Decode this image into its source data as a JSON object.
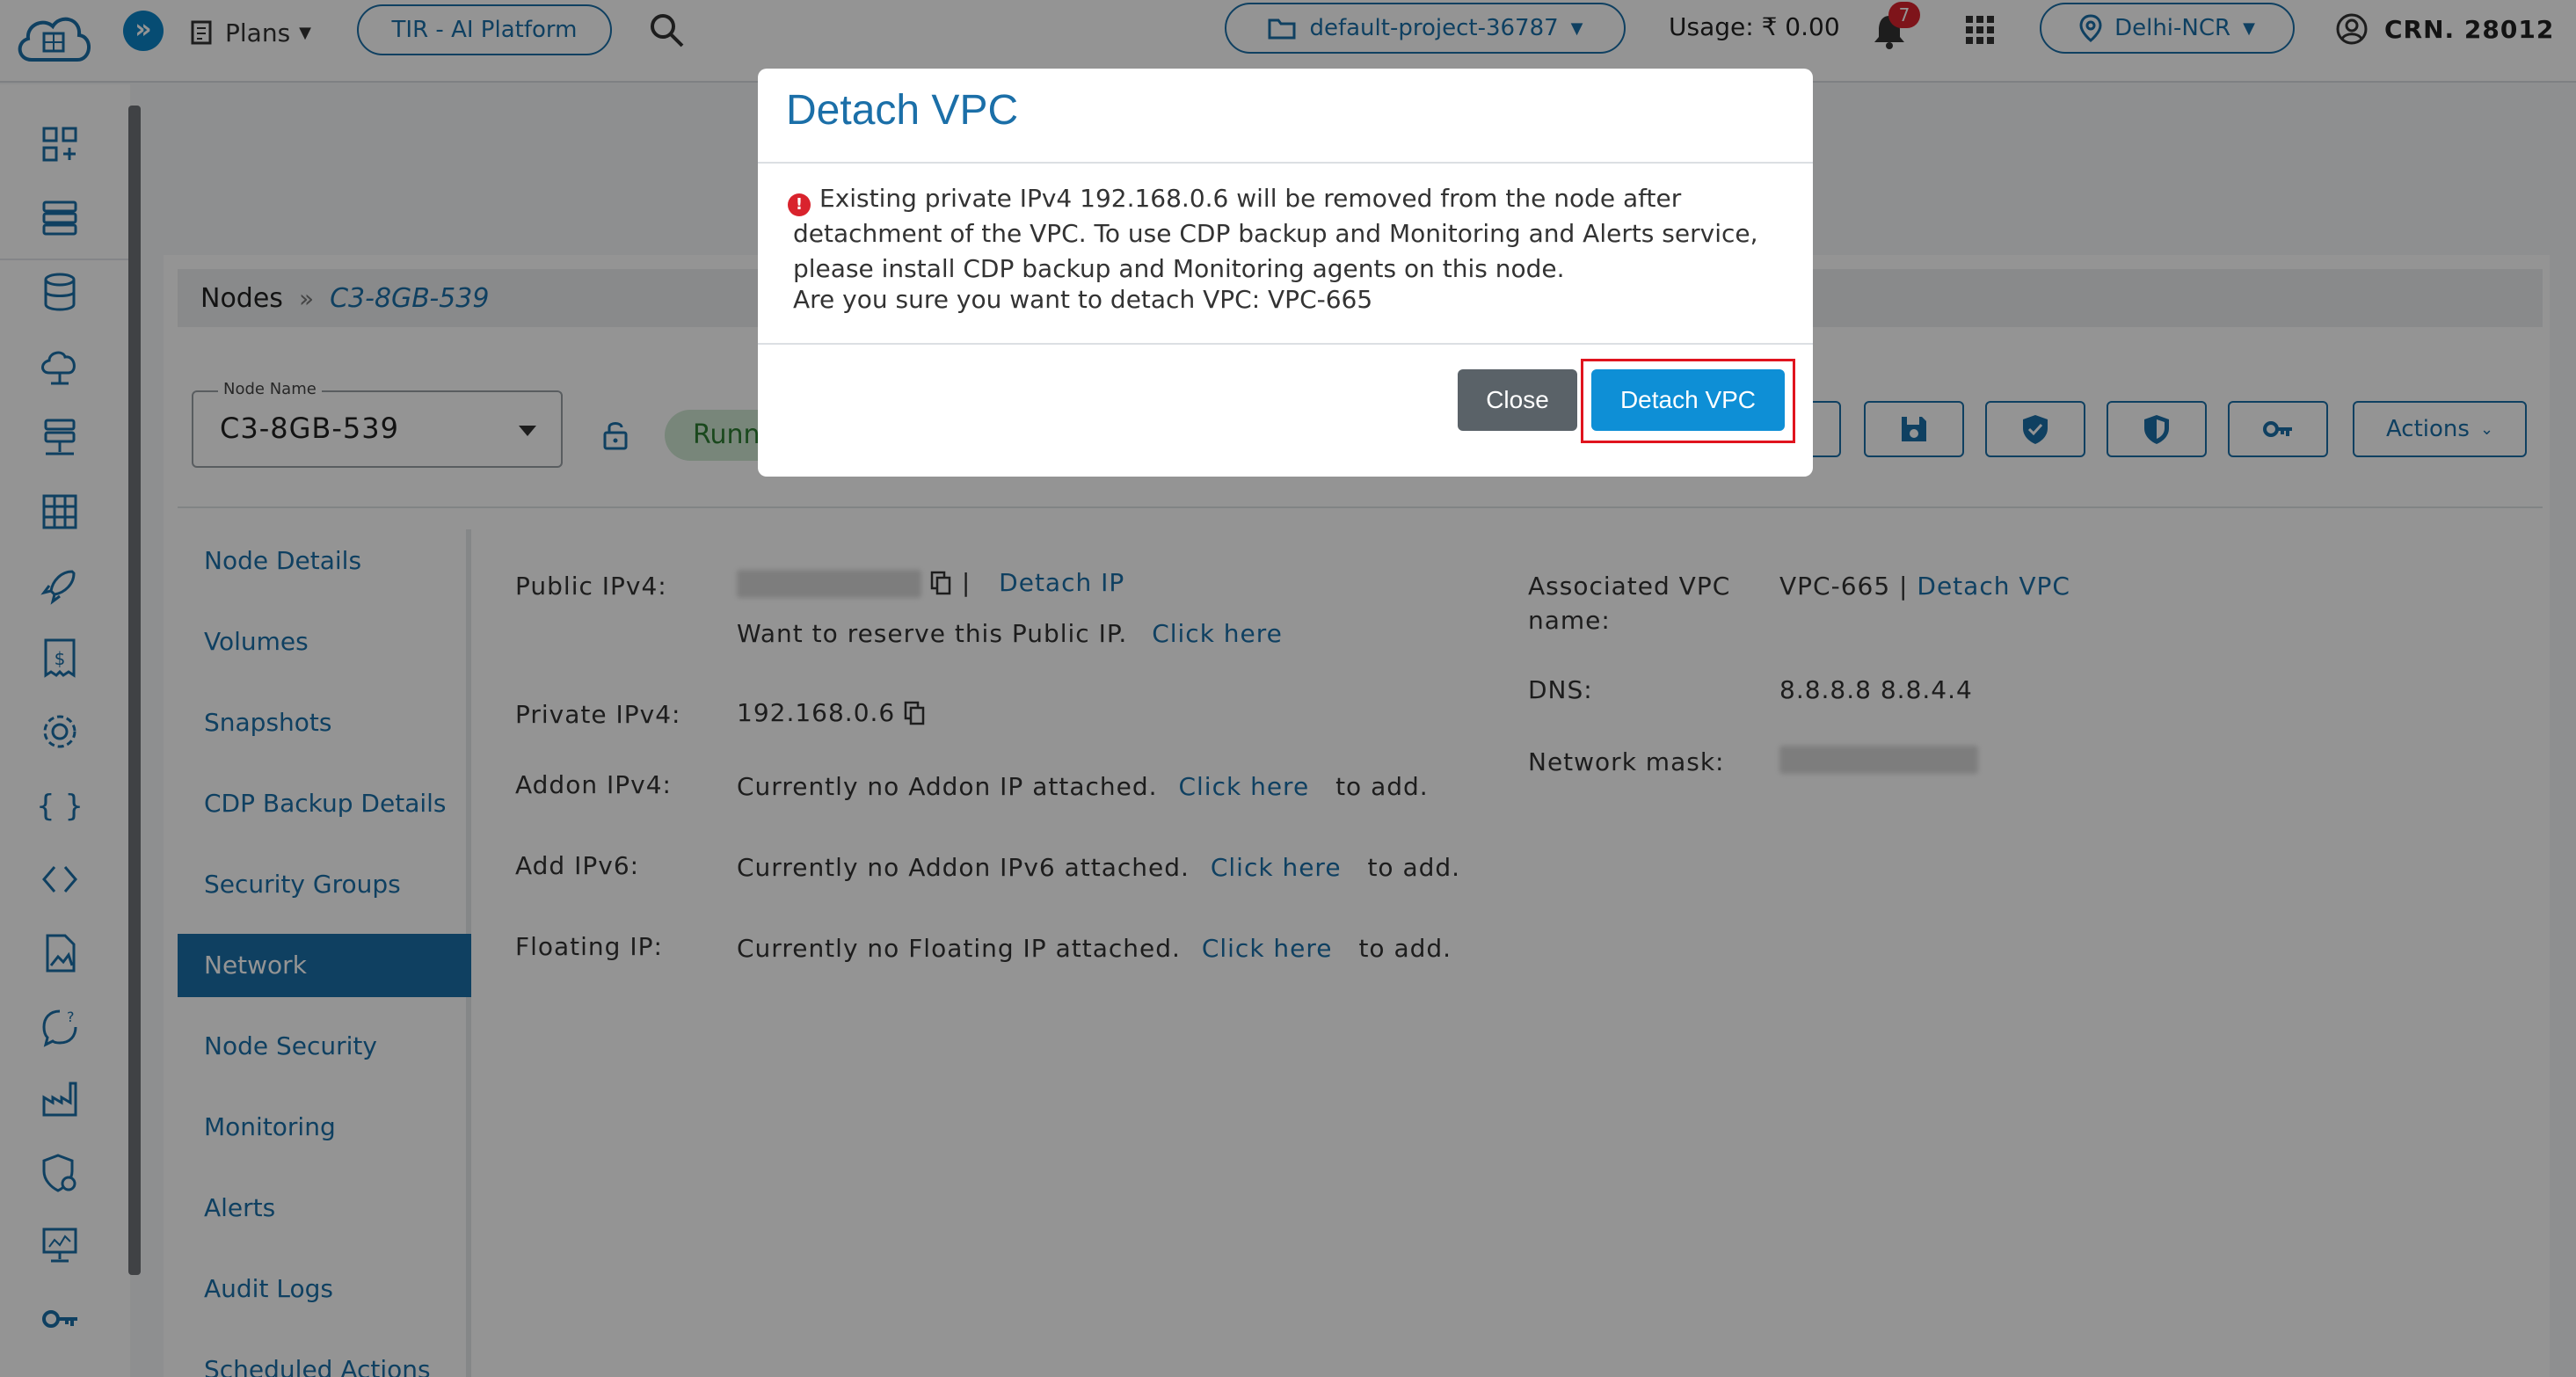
{
  "header": {
    "plans_label": "Plans",
    "tir_label": "TIR - AI Platform",
    "project_label": "default-project-36787",
    "usage_label": "Usage: ₹ 0.00",
    "notification_count": "7",
    "region_label": "Delhi-NCR",
    "crn_label": "CRN. 28012"
  },
  "breadcrumb": {
    "root": "Nodes",
    "separator": "»",
    "current": "C3-8GB-539"
  },
  "node": {
    "select_label": "Node Name",
    "select_value": "C3-8GB-539",
    "status": "Runn",
    "actions_label": "Actions"
  },
  "left_nav": {
    "items": [
      {
        "label": "Node Details"
      },
      {
        "label": "Volumes"
      },
      {
        "label": "Snapshots"
      },
      {
        "label": "CDP Backup Details"
      },
      {
        "label": "Security Groups"
      },
      {
        "label": "Network"
      },
      {
        "label": "Node Security"
      },
      {
        "label": "Monitoring"
      },
      {
        "label": "Alerts"
      },
      {
        "label": "Audit Logs"
      },
      {
        "label": "Scheduled Actions"
      }
    ]
  },
  "network": {
    "public_ipv4_label": "Public IPv4:",
    "public_ipv4_sep": "|",
    "detach_ip": "Detach IP",
    "reserve_text": "Want to reserve this Public IP.",
    "reserve_link": "Click here",
    "private_ipv4_label": "Private IPv4:",
    "private_ipv4_value": "192.168.0.6",
    "addon_ipv4_label": "Addon IPv4:",
    "addon_ipv4_text": "Currently no Addon IP attached.",
    "addon_ipv6_label": "Add IPv6:",
    "addon_ipv6_text": "Currently no Addon IPv6 attached.",
    "floating_ip_label": "Floating IP:",
    "floating_ip_text": "Currently no Floating IP attached.",
    "click_here": "Click here",
    "to_add": "to add.",
    "assoc_vpc_label_1": "Associated VPC",
    "assoc_vpc_label_2": "name:",
    "assoc_vpc_value": "VPC-665",
    "assoc_vpc_sep": "|",
    "detach_vpc_link": "Detach VPC",
    "dns_label": "DNS:",
    "dns_value": "8.8.8.8 8.8.4.4",
    "network_mask_label": "Network mask:"
  },
  "modal": {
    "title": "Detach VPC",
    "warning_icon": "!",
    "warning": "Existing private IPv4 192.168.0.6 will be removed from the node after detachment of the VPC. To use CDP backup and Monitoring and Alerts service, please install CDP backup and Monitoring agents on this node.",
    "question": "Are you sure you want to detach VPC: VPC-665",
    "close_label": "Close",
    "confirm_label": "Detach VPC"
  },
  "colors": {
    "accent": "#1b6fa8",
    "primary_button": "#0e8fd6",
    "secondary_button": "#5a6268",
    "danger": "#d9232d",
    "status_green": "#2e7d32"
  },
  "icons": [
    "cloud-logo-icon",
    "expand-icon",
    "plans-icon",
    "search-icon",
    "folder-icon",
    "bell-icon",
    "apps-grid-icon",
    "location-icon",
    "user-icon",
    "lock-icon",
    "save-icon",
    "shield-check-icon",
    "shield-icon",
    "key-icon",
    "copy-icon",
    "warning-icon"
  ]
}
